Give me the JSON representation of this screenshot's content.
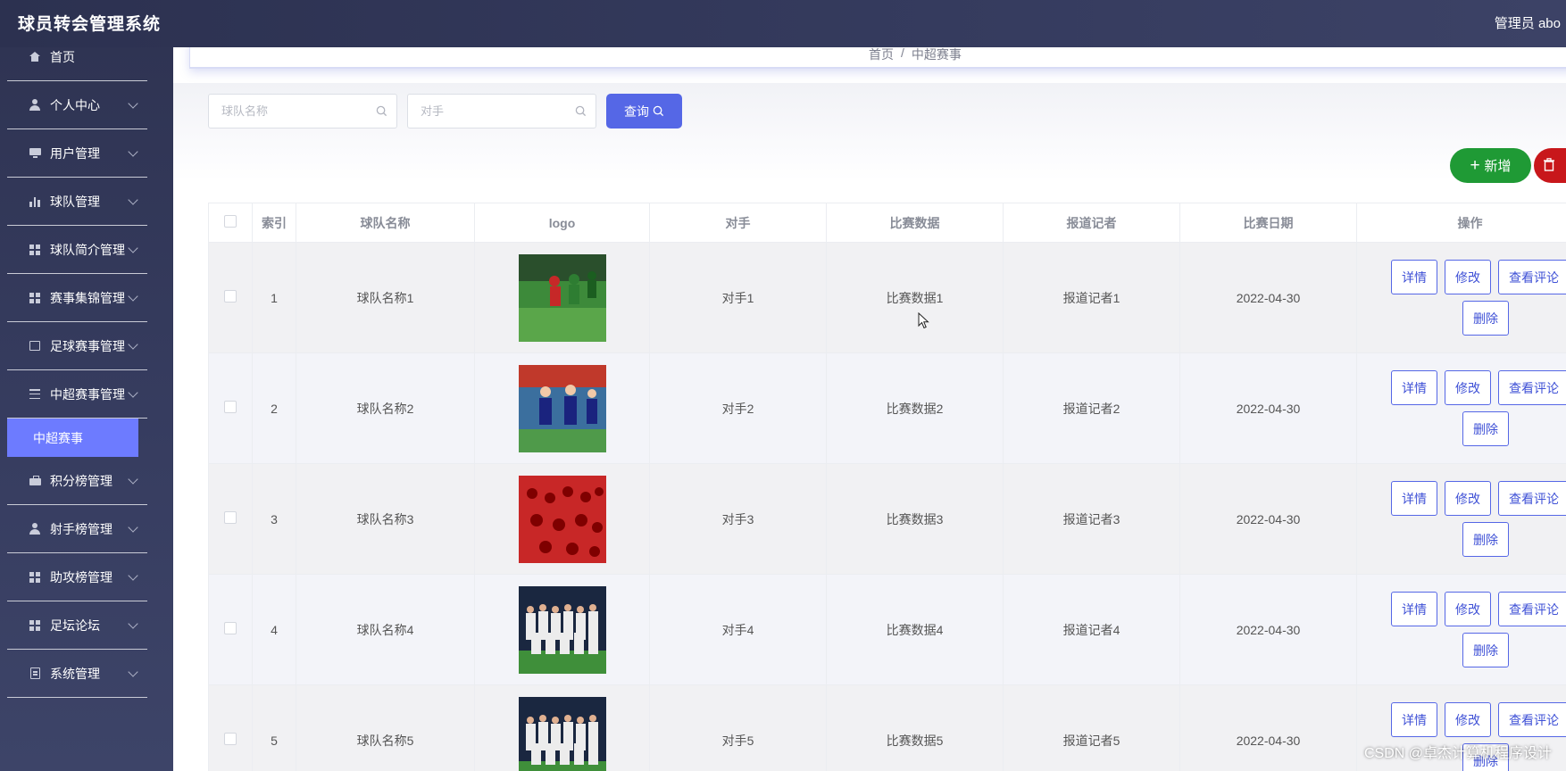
{
  "header": {
    "title": "球员转会管理系统",
    "user": "管理员 abo"
  },
  "sidebar": {
    "items": [
      {
        "label": "首页",
        "icon": "home-icon"
      },
      {
        "label": "个人中心",
        "icon": "user-icon"
      },
      {
        "label": "用户管理",
        "icon": "monitor-icon"
      },
      {
        "label": "球队管理",
        "icon": "bar-chart-icon"
      },
      {
        "label": "球队简介管理",
        "icon": "grid-icon"
      },
      {
        "label": "赛事集锦管理",
        "icon": "grid-icon"
      },
      {
        "label": "足球赛事管理",
        "icon": "chart-icon"
      },
      {
        "label": "中超赛事管理",
        "icon": "sliders-icon"
      },
      {
        "label": "积分榜管理",
        "icon": "briefcase-icon"
      },
      {
        "label": "射手榜管理",
        "icon": "user-icon"
      },
      {
        "label": "助攻榜管理",
        "icon": "grid-icon"
      },
      {
        "label": "足坛论坛",
        "icon": "grid-icon"
      },
      {
        "label": "系统管理",
        "icon": "clipboard-icon"
      }
    ],
    "active_sub": "中超赛事"
  },
  "breadcrumb": {
    "home": "首页",
    "sep": "/",
    "current": "中超赛事"
  },
  "search": {
    "team_placeholder": "球队名称",
    "opponent_placeholder": "对手",
    "query_label": "查询"
  },
  "actions": {
    "add_label": "新增"
  },
  "table": {
    "headers": {
      "index": "索引",
      "team": "球队名称",
      "logo": "logo",
      "opponent": "对手",
      "data": "比赛数据",
      "reporter": "报道记者",
      "date": "比赛日期",
      "ops": "操作"
    },
    "ops": {
      "detail": "详情",
      "edit": "修改",
      "review": "查看评论",
      "delete": "删除"
    },
    "rows": [
      {
        "index": "1",
        "team": "球队名称1",
        "opponent": "对手1",
        "data": "比赛数据1",
        "reporter": "报道记者1",
        "date": "2022-04-30"
      },
      {
        "index": "2",
        "team": "球队名称2",
        "opponent": "对手2",
        "data": "比赛数据2",
        "reporter": "报道记者2",
        "date": "2022-04-30"
      },
      {
        "index": "3",
        "team": "球队名称3",
        "opponent": "对手3",
        "data": "比赛数据3",
        "reporter": "报道记者3",
        "date": "2022-04-30"
      },
      {
        "index": "4",
        "team": "球队名称4",
        "opponent": "对手4",
        "data": "比赛数据4",
        "reporter": "报道记者4",
        "date": "2022-04-30"
      },
      {
        "index": "5",
        "team": "球队名称5",
        "opponent": "对手5",
        "data": "比赛数据5",
        "reporter": "报道记者5",
        "date": "2022-04-30"
      }
    ]
  },
  "watermark": "CSDN @卓杰计算机程序设计",
  "colors": {
    "primary": "#5567e6",
    "success": "#1f9a35",
    "danger": "#c8171b",
    "sidebar": "#2f3453",
    "active": "#6d7bff"
  }
}
